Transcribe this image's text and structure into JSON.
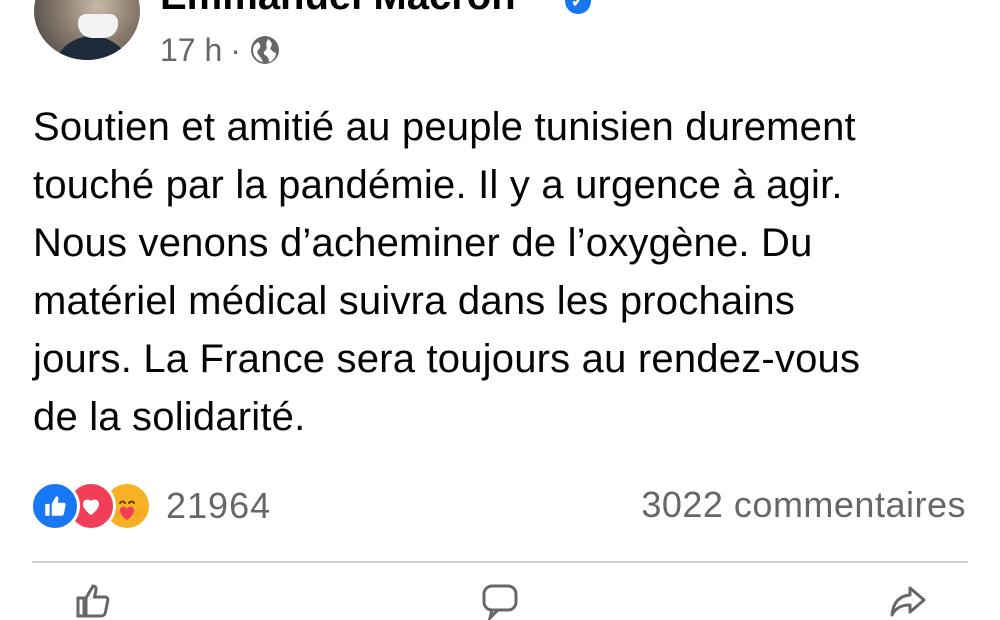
{
  "post": {
    "author": "Emmanuel Macron",
    "time": "17 h",
    "separator": "·",
    "text": "Soutien et amitié au peuple tunisien durement\ntouché par la pandémie. Il y a urgence à agir.\nNous venons d’acheminer de l’oxygène. Du\nmatériel médical suivra dans les prochains\njours. La France sera toujours au rendez-vous\nde la solidarité."
  },
  "stats": {
    "reactions_count": "21964",
    "comments": "3022 commentaires"
  },
  "icons": {
    "verified": "verified-badge-icon",
    "audience": "globe-icon",
    "reactions": [
      "like-icon",
      "love-icon",
      "care-icon"
    ],
    "actions": [
      "like-icon",
      "comment-icon",
      "share-icon"
    ]
  },
  "colors": {
    "facebook_blue": "#1877f2",
    "love_red": "#f33e58",
    "care_yellow": "#f7b125",
    "secondary_text": "#65676b"
  }
}
